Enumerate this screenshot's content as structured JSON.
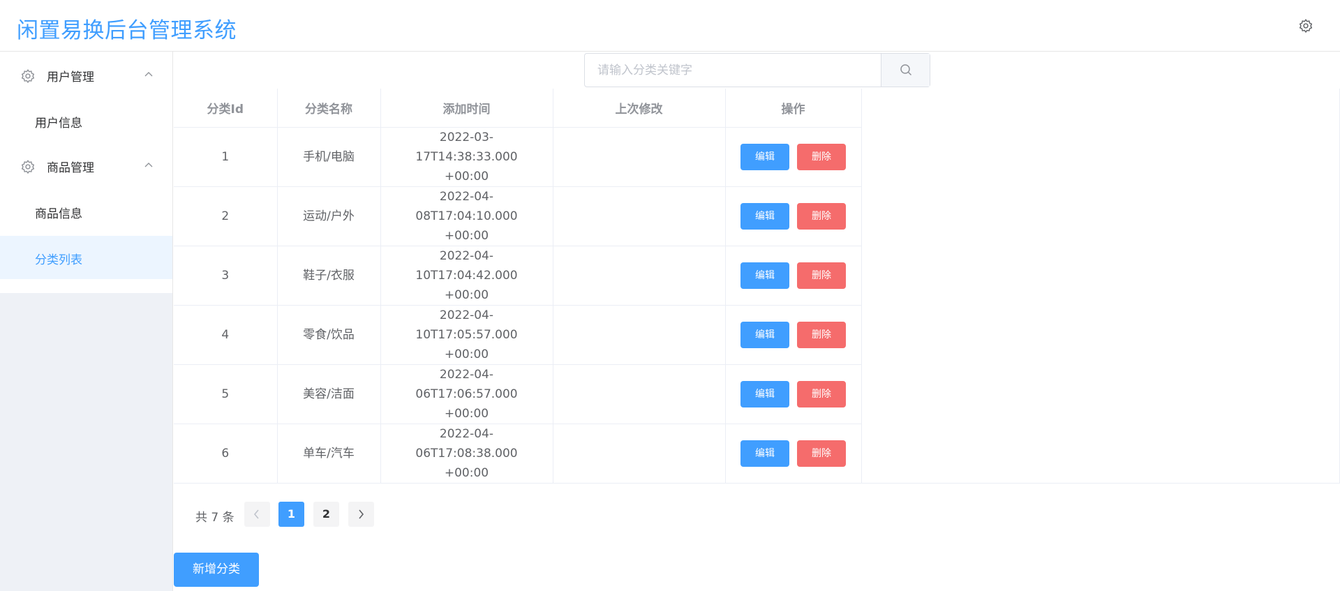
{
  "header": {
    "title": "闲置易换后台管理系统",
    "settings_icon": "gear-icon"
  },
  "sidebar": {
    "groups": [
      {
        "label": "用户管理",
        "icon": "gear-icon",
        "items": [
          "用户信息"
        ]
      },
      {
        "label": "商品管理",
        "icon": "gear-icon",
        "items": [
          "商品信息",
          "分类列表"
        ]
      }
    ],
    "active_item": "分类列表"
  },
  "search": {
    "placeholder": "请输入分类关键字",
    "value": "",
    "icon": "search-icon"
  },
  "table": {
    "columns": [
      "分类Id",
      "分类名称",
      "添加时间",
      "上次修改",
      "操作"
    ],
    "rows": [
      {
        "id": "1",
        "name": "手机/电脑",
        "added_date": "2022-03-17T14:38:33.000",
        "added_tz": "+00:00",
        "modified": ""
      },
      {
        "id": "2",
        "name": "运动/户外",
        "added_date": "2022-04-08T17:04:10.000",
        "added_tz": "+00:00",
        "modified": ""
      },
      {
        "id": "3",
        "name": "鞋子/衣服",
        "added_date": "2022-04-10T17:04:42.000",
        "added_tz": "+00:00",
        "modified": ""
      },
      {
        "id": "4",
        "name": "零食/饮品",
        "added_date": "2022-04-10T17:05:57.000",
        "added_tz": "+00:00",
        "modified": ""
      },
      {
        "id": "5",
        "name": "美容/洁面",
        "added_date": "2022-04-06T17:06:57.000",
        "added_tz": "+00:00",
        "modified": ""
      },
      {
        "id": "6",
        "name": "单车/汽车",
        "added_date": "2022-04-06T17:08:38.000",
        "added_tz": "+00:00",
        "modified": ""
      }
    ],
    "edit_label": "编辑",
    "delete_label": "删除"
  },
  "pagination": {
    "total_text": "共 7 条",
    "pages": [
      "1",
      "2"
    ],
    "current_page": "1"
  },
  "add_button": "新增分类",
  "colors": {
    "primary": "#409eff",
    "danger": "#f56c6c",
    "active_bg": "#ecf5ff"
  }
}
